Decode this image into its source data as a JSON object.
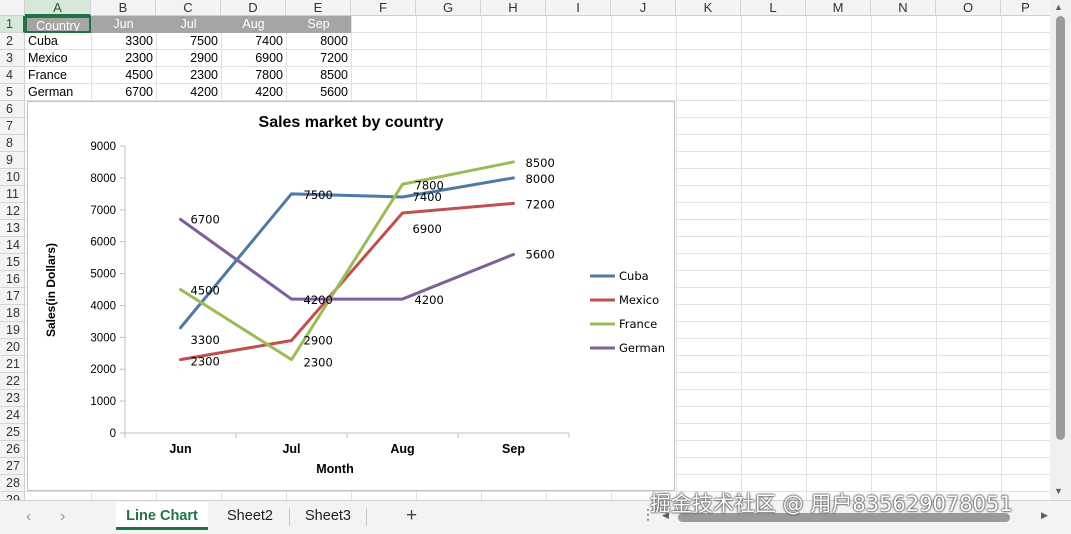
{
  "columns": [
    "A",
    "B",
    "C",
    "D",
    "E",
    "F",
    "G",
    "H",
    "I",
    "J",
    "K",
    "L",
    "M",
    "N",
    "O",
    "P"
  ],
  "rows": [
    "1",
    "2",
    "3",
    "4",
    "5",
    "6",
    "7",
    "8",
    "9",
    "10",
    "11",
    "12",
    "13",
    "14",
    "15",
    "16",
    "17",
    "18",
    "19",
    "20",
    "21",
    "22",
    "23",
    "24",
    "25",
    "26",
    "27",
    "28",
    "29"
  ],
  "table": {
    "header": [
      "Country",
      "Jun",
      "Jul",
      "Aug",
      "Sep"
    ],
    "data": [
      [
        "Cuba",
        "3300",
        "7500",
        "7400",
        "8000"
      ],
      [
        "Mexico",
        "2300",
        "2900",
        "6900",
        "7200"
      ],
      [
        "France",
        "4500",
        "2300",
        "7800",
        "8500"
      ],
      [
        "German",
        "6700",
        "4200",
        "4200",
        "5600"
      ]
    ]
  },
  "chart_data": {
    "type": "line",
    "title": "Sales market by country",
    "xlabel": "Month",
    "ylabel": "Sales(in Dollars)",
    "categories": [
      "Jun",
      "Jul",
      "Aug",
      "Sep"
    ],
    "ylim": [
      0,
      9000
    ],
    "yticks": [
      0,
      1000,
      2000,
      3000,
      4000,
      5000,
      6000,
      7000,
      8000,
      9000
    ],
    "grid": false,
    "legend_position": "right",
    "series": [
      {
        "name": "Cuba",
        "color": "#4e79a7",
        "values": [
          3300,
          7500,
          7400,
          8000
        ]
      },
      {
        "name": "Mexico",
        "color": "#c0504d",
        "values": [
          2300,
          2900,
          6900,
          7200
        ]
      },
      {
        "name": "France",
        "color": "#9bbb59",
        "values": [
          4500,
          2300,
          7800,
          8500
        ]
      },
      {
        "name": "German",
        "color": "#7f5f9b",
        "values": [
          6700,
          4200,
          4200,
          5600
        ]
      }
    ]
  },
  "tabs": {
    "sheet1": "Line Chart",
    "sheet2": "Sheet2",
    "sheet3": "Sheet3",
    "add": "+"
  },
  "nav": {
    "prev": "‹",
    "next": "›",
    "more": "⋮"
  },
  "watermark": "掘金技术社区 @ 用户835629078051",
  "colors": {
    "accent": "#217346",
    "header_fill": "#a5a5a5"
  }
}
